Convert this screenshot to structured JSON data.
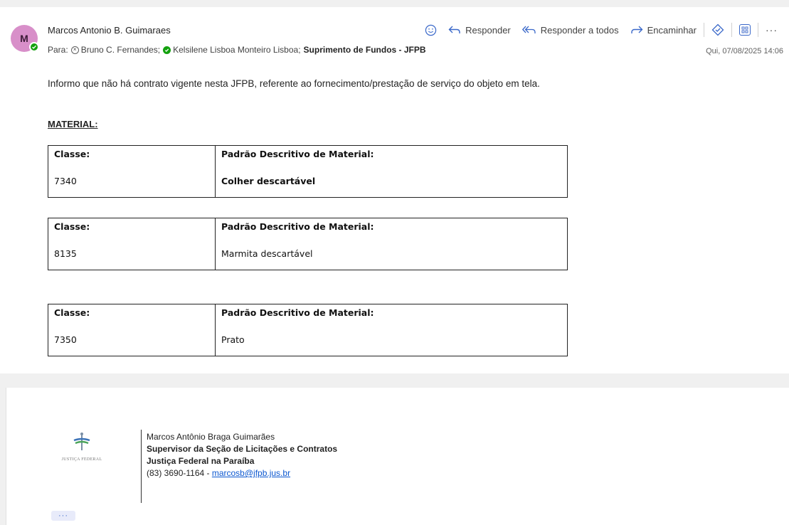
{
  "header": {
    "avatar_initial": "M",
    "sender": "Marcos Antonio B. Guimaraes",
    "to_prefix": "Para:",
    "recipients": [
      {
        "name": "Bruno C. Fernandes;",
        "status": "unknown",
        "bold": false
      },
      {
        "name": "Kelsilene Lisboa Monteiro Lisboa;",
        "status": "available",
        "bold": false
      },
      {
        "name": "Suprimento de Fundos - JFPB",
        "status": "none",
        "bold": true
      }
    ],
    "date": "Qui, 07/08/2025 14:06"
  },
  "toolbar": {
    "reply": "Responder",
    "reply_all": "Responder a todos",
    "forward": "Encaminhar",
    "more": "···"
  },
  "body": {
    "intro": "Informo que não há contrato vigente nesta JFPB, referente ao fornecimento/prestação de serviço do objeto em tela.",
    "section_title": "MATERIAL: ",
    "tables": [
      {
        "h1": "Classe:",
        "h2": "Padrão Descritivo de Material:",
        "v1": "7340",
        "v2": "Colher descartável",
        "v2_bold": true
      },
      {
        "h1": "Classe:",
        "h2": "Padrão Descritivo de Material:",
        "v1": "8135",
        "v2": "Marmita descartável",
        "v2_bold": false
      },
      {
        "h1": "Classe:",
        "h2": "Padrão Descritivo de Material:",
        "v1": "7350",
        "v2": "Prato",
        "v2_bold": false
      }
    ]
  },
  "signature": {
    "logo_text": "JUSTIÇA FEDERAL",
    "name": "Marcos Antônio Braga Guimarães",
    "role": "Supervisor da Seção de Licitações e Contratos",
    "org": "Justiça Federal na Paraíba",
    "phone": "(83) 3690-1164 - ",
    "email": "marcosb@jfpb.jus.br"
  },
  "expand_label": "···",
  "colors": {
    "accent": "#3a68c9",
    "avatar": "#d88fc9",
    "presence": "#13a10e"
  }
}
